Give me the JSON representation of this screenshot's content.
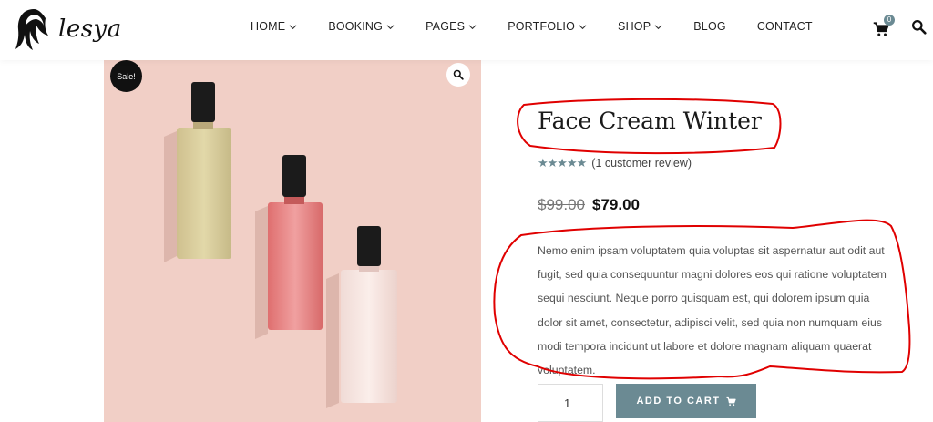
{
  "header": {
    "logo_text": "lesya",
    "nav": [
      {
        "label": "HOME",
        "dropdown": true
      },
      {
        "label": "BOOKING",
        "dropdown": true
      },
      {
        "label": "PAGES",
        "dropdown": true
      },
      {
        "label": "PORTFOLIO",
        "dropdown": true
      },
      {
        "label": "SHOP",
        "dropdown": true
      },
      {
        "label": "BLOG",
        "dropdown": false
      },
      {
        "label": "CONTACT",
        "dropdown": false
      }
    ],
    "cart_count": "0"
  },
  "gallery": {
    "sale_label": "Sale!"
  },
  "product": {
    "title": "Face Cream Winter",
    "rating": 5,
    "review_text": "(1 customer review)",
    "old_price": "$99.00",
    "new_price": "$79.00",
    "description": "Nemo enim ipsam voluptatem quia voluptas sit aspernatur aut odit aut fugit, sed quia consequuntur magni dolores eos qui ratione voluptatem sequi nesciunt. Neque porro quisquam est, qui dolorem ipsum quia dolor sit amet, consectetur, adipisci velit, sed quia non numquam eius modi tempora incidunt ut labore et dolore magnam aliquam quaerat voluptatem.",
    "quantity": "1",
    "add_to_cart_label": "ADD TO CART"
  },
  "colors": {
    "accent": "#6b8a93",
    "gallery_bg": "#f1cfc6",
    "annotation": "#e00000"
  }
}
